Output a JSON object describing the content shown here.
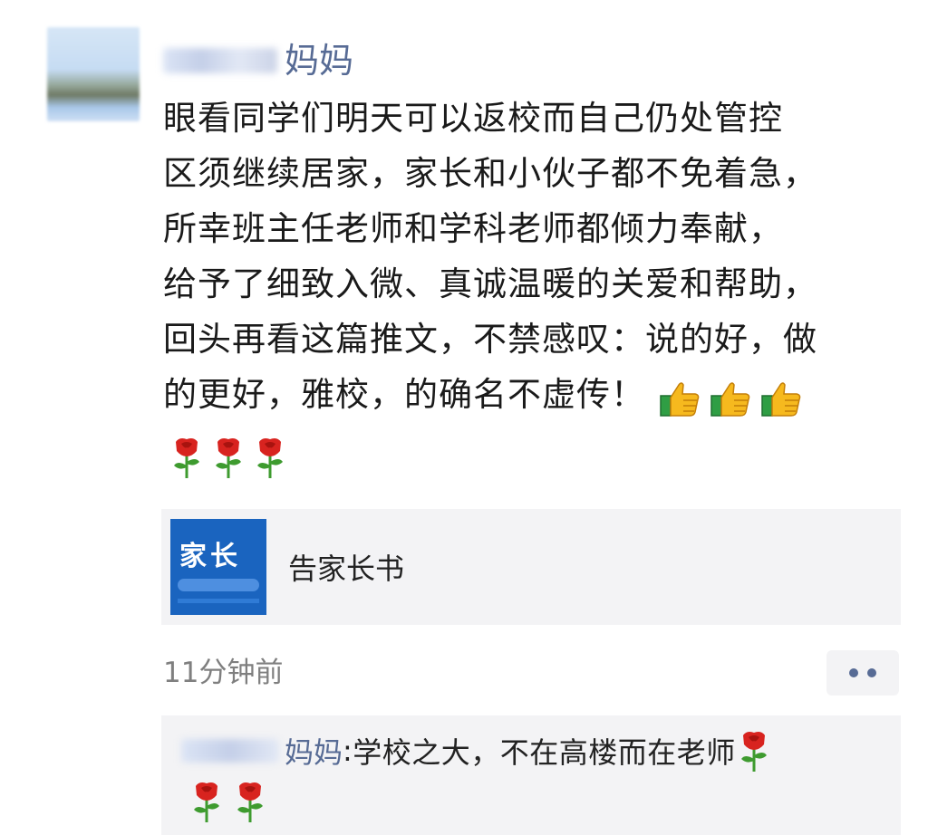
{
  "post": {
    "author_suffix": "妈妈",
    "lines": [
      "眼看同学们明天可以返校而自己仍处管控",
      "区须继续居家，家长和小伙子都不免着急，",
      "所幸班主任老师和学科老师都倾力奉献，",
      "给予了细致入微、真诚温暖的关爱和帮助，",
      "回头再看这篇推文，不禁感叹：说的好，做",
      "的更好，雅校，的确名不虚传！"
    ],
    "emoji_after_text": [
      "thumbs-up-icon",
      "thumbs-up-icon",
      "thumbs-up-icon"
    ],
    "emoji_row": [
      "rose-icon",
      "rose-icon",
      "rose-icon"
    ]
  },
  "link_card": {
    "thumb_text": "家长",
    "title": "告家长书"
  },
  "meta": {
    "time": "11分钟前"
  },
  "comment": {
    "author_suffix": "妈妈",
    "separator": ": ",
    "text": "学校之大，不在高楼而在老师",
    "emoji_after_text": [
      "rose-icon"
    ],
    "emoji_row": [
      "rose-icon",
      "rose-icon"
    ]
  },
  "colors": {
    "nickname": "#576b95",
    "card_bg": "#f3f3f5",
    "thumb_bg": "#1a64bf",
    "rose_red": "#d8231f",
    "stem_green": "#3e9b2f"
  }
}
